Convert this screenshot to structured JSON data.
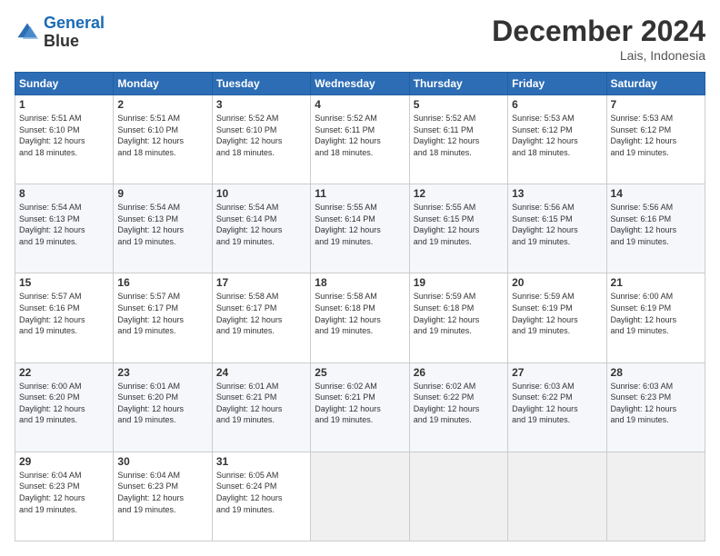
{
  "logo": {
    "line1": "General",
    "line2": "Blue"
  },
  "header": {
    "title": "December 2024",
    "subtitle": "Lais, Indonesia"
  },
  "weekdays": [
    "Sunday",
    "Monday",
    "Tuesday",
    "Wednesday",
    "Thursday",
    "Friday",
    "Saturday"
  ],
  "weeks": [
    [
      {
        "day": 1,
        "sunrise": "5:51 AM",
        "sunset": "6:10 PM",
        "daylight": "12 hours and 18 minutes."
      },
      {
        "day": 2,
        "sunrise": "5:51 AM",
        "sunset": "6:10 PM",
        "daylight": "12 hours and 18 minutes."
      },
      {
        "day": 3,
        "sunrise": "5:52 AM",
        "sunset": "6:10 PM",
        "daylight": "12 hours and 18 minutes."
      },
      {
        "day": 4,
        "sunrise": "5:52 AM",
        "sunset": "6:11 PM",
        "daylight": "12 hours and 18 minutes."
      },
      {
        "day": 5,
        "sunrise": "5:52 AM",
        "sunset": "6:11 PM",
        "daylight": "12 hours and 18 minutes."
      },
      {
        "day": 6,
        "sunrise": "5:53 AM",
        "sunset": "6:12 PM",
        "daylight": "12 hours and 18 minutes."
      },
      {
        "day": 7,
        "sunrise": "5:53 AM",
        "sunset": "6:12 PM",
        "daylight": "12 hours and 19 minutes."
      }
    ],
    [
      {
        "day": 8,
        "sunrise": "5:54 AM",
        "sunset": "6:13 PM",
        "daylight": "12 hours and 19 minutes."
      },
      {
        "day": 9,
        "sunrise": "5:54 AM",
        "sunset": "6:13 PM",
        "daylight": "12 hours and 19 minutes."
      },
      {
        "day": 10,
        "sunrise": "5:54 AM",
        "sunset": "6:14 PM",
        "daylight": "12 hours and 19 minutes."
      },
      {
        "day": 11,
        "sunrise": "5:55 AM",
        "sunset": "6:14 PM",
        "daylight": "12 hours and 19 minutes."
      },
      {
        "day": 12,
        "sunrise": "5:55 AM",
        "sunset": "6:15 PM",
        "daylight": "12 hours and 19 minutes."
      },
      {
        "day": 13,
        "sunrise": "5:56 AM",
        "sunset": "6:15 PM",
        "daylight": "12 hours and 19 minutes."
      },
      {
        "day": 14,
        "sunrise": "5:56 AM",
        "sunset": "6:16 PM",
        "daylight": "12 hours and 19 minutes."
      }
    ],
    [
      {
        "day": 15,
        "sunrise": "5:57 AM",
        "sunset": "6:16 PM",
        "daylight": "12 hours and 19 minutes."
      },
      {
        "day": 16,
        "sunrise": "5:57 AM",
        "sunset": "6:17 PM",
        "daylight": "12 hours and 19 minutes."
      },
      {
        "day": 17,
        "sunrise": "5:58 AM",
        "sunset": "6:17 PM",
        "daylight": "12 hours and 19 minutes."
      },
      {
        "day": 18,
        "sunrise": "5:58 AM",
        "sunset": "6:18 PM",
        "daylight": "12 hours and 19 minutes."
      },
      {
        "day": 19,
        "sunrise": "5:59 AM",
        "sunset": "6:18 PM",
        "daylight": "12 hours and 19 minutes."
      },
      {
        "day": 20,
        "sunrise": "5:59 AM",
        "sunset": "6:19 PM",
        "daylight": "12 hours and 19 minutes."
      },
      {
        "day": 21,
        "sunrise": "6:00 AM",
        "sunset": "6:19 PM",
        "daylight": "12 hours and 19 minutes."
      }
    ],
    [
      {
        "day": 22,
        "sunrise": "6:00 AM",
        "sunset": "6:20 PM",
        "daylight": "12 hours and 19 minutes."
      },
      {
        "day": 23,
        "sunrise": "6:01 AM",
        "sunset": "6:20 PM",
        "daylight": "12 hours and 19 minutes."
      },
      {
        "day": 24,
        "sunrise": "6:01 AM",
        "sunset": "6:21 PM",
        "daylight": "12 hours and 19 minutes."
      },
      {
        "day": 25,
        "sunrise": "6:02 AM",
        "sunset": "6:21 PM",
        "daylight": "12 hours and 19 minutes."
      },
      {
        "day": 26,
        "sunrise": "6:02 AM",
        "sunset": "6:22 PM",
        "daylight": "12 hours and 19 minutes."
      },
      {
        "day": 27,
        "sunrise": "6:03 AM",
        "sunset": "6:22 PM",
        "daylight": "12 hours and 19 minutes."
      },
      {
        "day": 28,
        "sunrise": "6:03 AM",
        "sunset": "6:23 PM",
        "daylight": "12 hours and 19 minutes."
      }
    ],
    [
      {
        "day": 29,
        "sunrise": "6:04 AM",
        "sunset": "6:23 PM",
        "daylight": "12 hours and 19 minutes."
      },
      {
        "day": 30,
        "sunrise": "6:04 AM",
        "sunset": "6:23 PM",
        "daylight": "12 hours and 19 minutes."
      },
      {
        "day": 31,
        "sunrise": "6:05 AM",
        "sunset": "6:24 PM",
        "daylight": "12 hours and 19 minutes."
      },
      null,
      null,
      null,
      null
    ]
  ],
  "labels": {
    "sunrise": "Sunrise:",
    "sunset": "Sunset:",
    "daylight": "Daylight:"
  }
}
